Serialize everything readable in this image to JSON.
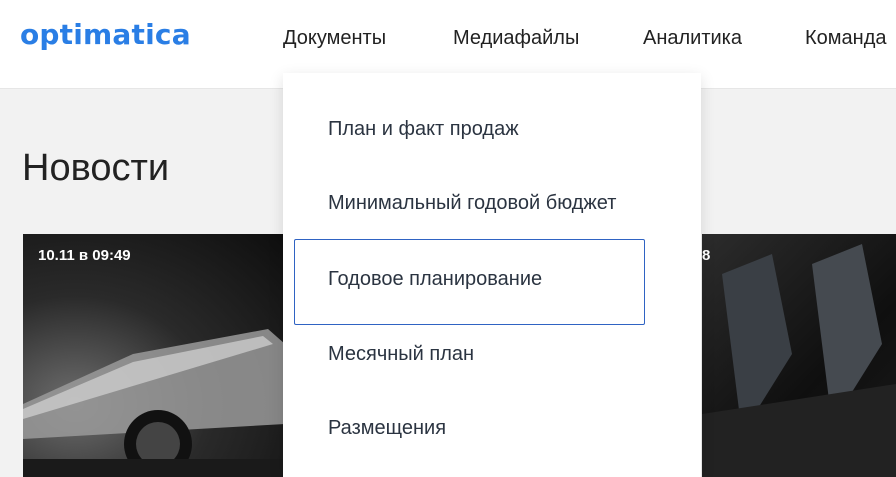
{
  "header": {
    "logo": "optimatica",
    "nav": [
      {
        "label": "Документы"
      },
      {
        "label": "Медиафайлы"
      },
      {
        "label": "Аналитика"
      },
      {
        "label": "Команда"
      }
    ]
  },
  "page": {
    "title": "Новости"
  },
  "cards": [
    {
      "date": "10.11 в 09:49"
    },
    {
      "date": "8"
    }
  ],
  "dropdown": {
    "items": [
      {
        "label": "План и факт продаж"
      },
      {
        "label": "Минимальный годовой бюджет"
      },
      {
        "label": "Годовое планирование"
      },
      {
        "label": "Месячный план"
      },
      {
        "label": "Размещения"
      }
    ]
  },
  "colors": {
    "brand": "#2a7ee5",
    "focus_border": "#2f63c3",
    "page_bg": "#f2f2f2"
  }
}
